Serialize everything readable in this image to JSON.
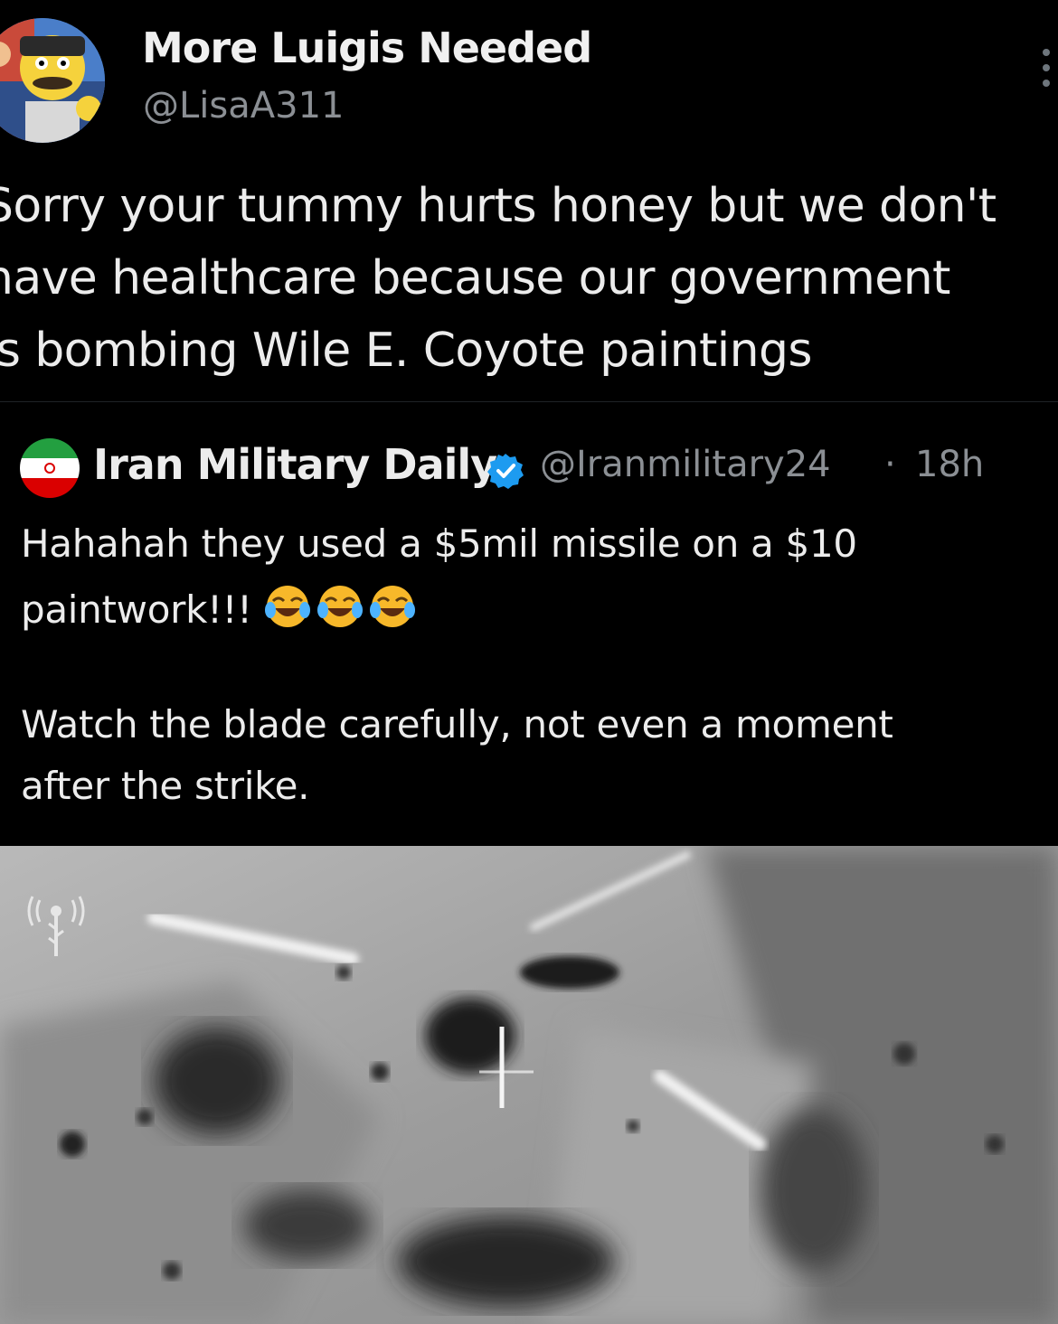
{
  "post": {
    "author": {
      "display_name": "More Luigis Needed",
      "handle": "@LisaA311"
    },
    "text_lines": [
      "Sorry your tummy hurts honey but we don't",
      "have healthcare because our government",
      "is bombing Wile E. Coyote paintings"
    ]
  },
  "quoted_post": {
    "author": {
      "display_name": "Iran Military Daily",
      "handle": "@Iranmilitary24",
      "verified": true
    },
    "separator": "·",
    "time": "18h",
    "text_lines": [
      "Hahahah they used a $5mil missile on a $10",
      "paintwork!!!",
      "Watch the blade carefully, not even a moment",
      "after the strike."
    ],
    "emojis": [
      "face-with-tears-of-joy-icon",
      "face-with-tears-of-joy-icon",
      "face-with-tears-of-joy-icon"
    ]
  },
  "colors": {
    "background": "#000000",
    "text_primary": "#ececec",
    "text_secondary": "#8b8f94",
    "verified_blue": "#1d9bf0"
  }
}
